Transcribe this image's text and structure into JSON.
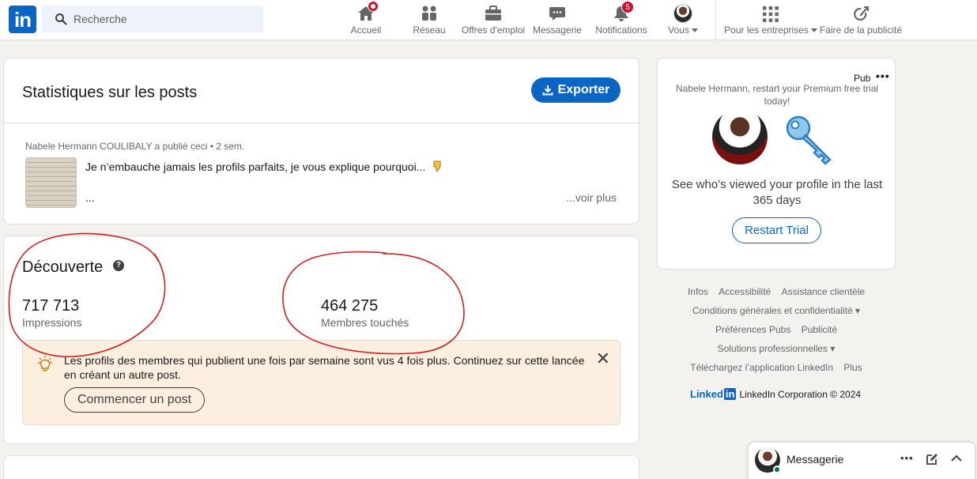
{
  "nav": {
    "logo_text": "in",
    "search_placeholder": "Recherche",
    "items": [
      {
        "label": "Accueil",
        "icon": "home-icon"
      },
      {
        "label": "Réseau",
        "icon": "network-icon"
      },
      {
        "label": "Offres d'emploi",
        "icon": "briefcase-icon"
      },
      {
        "label": "Messagerie",
        "icon": "chat-icon"
      },
      {
        "label": "Notifications",
        "icon": "bell-icon",
        "badge": "5"
      },
      {
        "label": "Vous",
        "icon": "avatar"
      },
      {
        "label": "Pour les entreprises",
        "icon": "grid-icon"
      },
      {
        "label": "Faire de la publicité",
        "icon": "ads-icon"
      }
    ]
  },
  "stats_card": {
    "title": "Statistiques sur les posts",
    "export_label": "Exporter",
    "post_author": "Nabele Hermann COULIBALY",
    "post_meta": "a publié ceci • 2 sem.",
    "post_text": "Je n’embauche jamais les profils parfaits, je vous explique pourquoi...",
    "post_ellipsis": "...",
    "see_more": "...voir plus"
  },
  "discovery": {
    "title": "Découverte",
    "help": "?",
    "impressions_value": "717 713",
    "impressions_label": "Impressions",
    "members_value": "464 275",
    "members_label": "Membres touchés",
    "tip_text": "Les profils des membres qui publient une fois par semaine sont vus 4 fois plus. Continuez sur cette lancée en créant un autre post.",
    "tip_button": "Commencer un post",
    "tip_close": "✕"
  },
  "ad": {
    "pub_label": "Pub",
    "more": "•••",
    "line": "Nabele Hermann, restart your Premium free trial today!",
    "headline": "See who's viewed your profile in the last 365 days",
    "button": "Restart Trial"
  },
  "footer": {
    "rows": [
      [
        "Infos",
        "Accessibilité",
        "Assistance clientèle"
      ],
      [
        "Conditions générales et confidentialité ▾"
      ],
      [
        "Préférences Pubs",
        "Publicité"
      ],
      [
        "Solutions professionnelles ▾"
      ],
      [
        "Téléchargez l’application LinkedIn",
        "Plus"
      ]
    ],
    "brand": "Linked",
    "brand_in": "in",
    "copyright": "LinkedIn Corporation © 2024"
  },
  "messaging": {
    "title": "Messagerie",
    "more": "•••"
  },
  "colors": {
    "brand_blue": "#0a66c2",
    "badge_red": "#cb112d",
    "tip_bg": "#fcefe0",
    "annotation_red": "#d21f1f"
  }
}
